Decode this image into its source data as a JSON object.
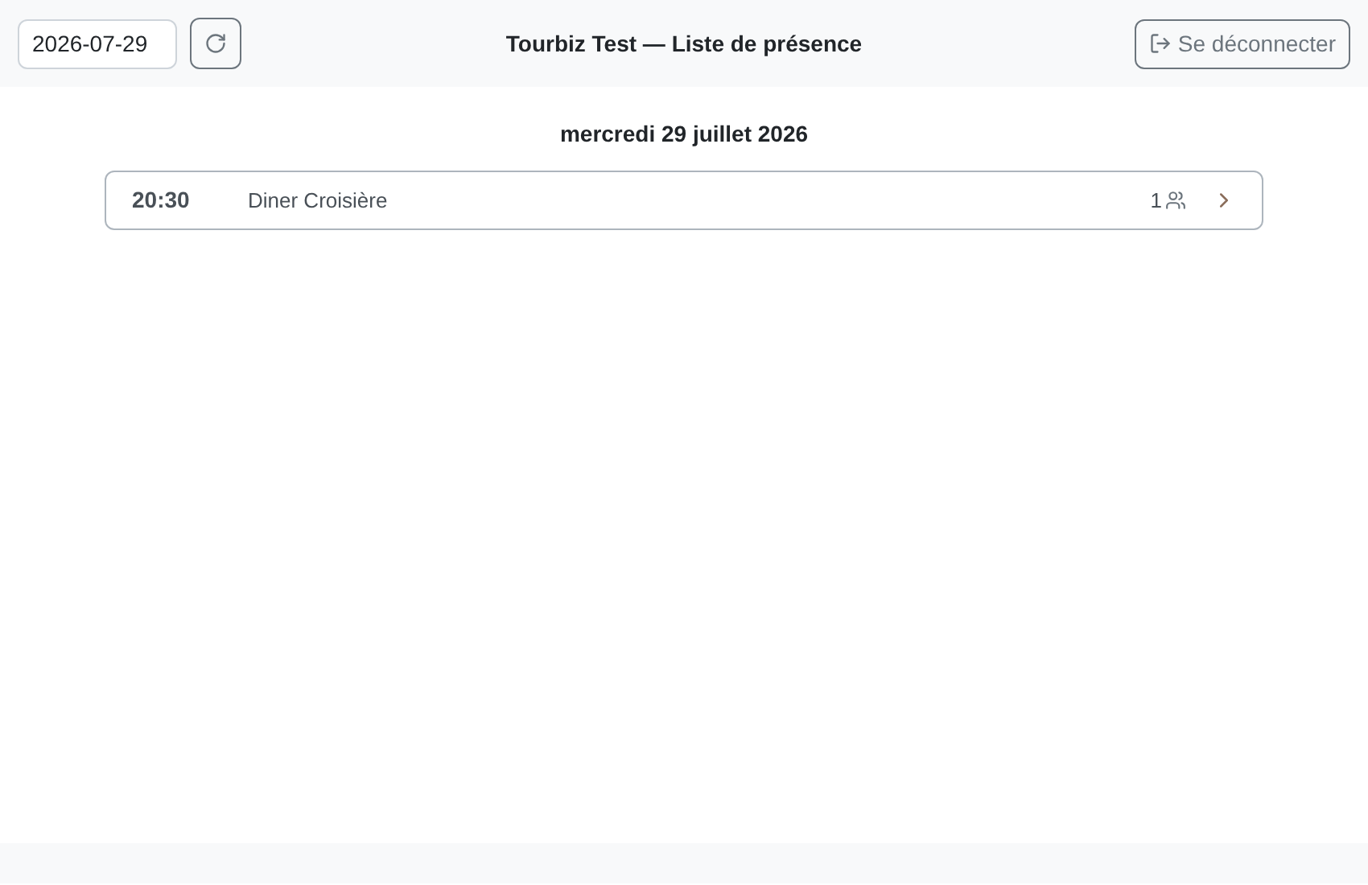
{
  "header": {
    "date_value": "2026-07-29",
    "title": "Tourbiz Test — Liste de présence",
    "logout_label": "Se déconnecter"
  },
  "day_heading": "mercredi 29 juillet 2026",
  "events": [
    {
      "time": "20:30",
      "name": "Diner Croisière",
      "count": "1"
    }
  ]
}
